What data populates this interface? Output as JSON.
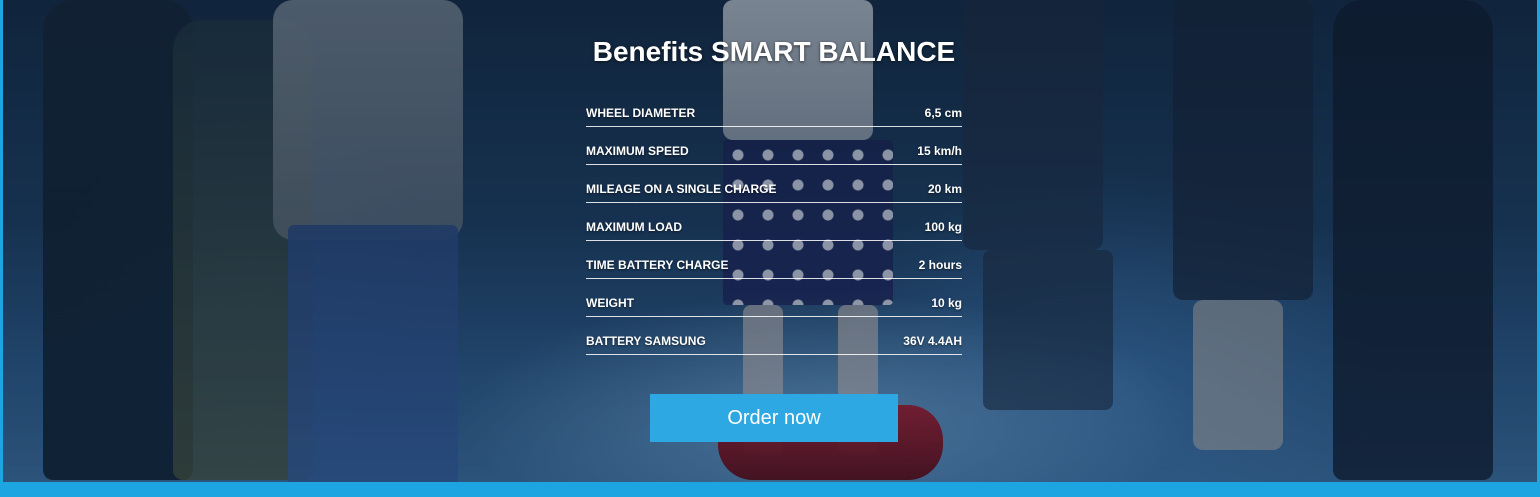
{
  "section": {
    "title": "Benefits SMART BALANCE",
    "specs": [
      {
        "label": "WHEEL DIAMETER",
        "value": "6,5 cm"
      },
      {
        "label": "MAXIMUM SPEED",
        "value": "15 km/h"
      },
      {
        "label": "MILEAGE ON A SINGLE CHARGE",
        "value": "20 km"
      },
      {
        "label": "MAXIMUM LOAD",
        "value": "100 kg"
      },
      {
        "label": "TIME BATTERY CHARGE",
        "value": "2 hours"
      },
      {
        "label": "WEIGHT",
        "value": "10 kg"
      },
      {
        "label": "BATTERY SAMSUNG",
        "value": "36V 4.4AH"
      }
    ],
    "order_button": "Order now"
  },
  "colors": {
    "accent": "#1ca5e0",
    "button": "#2da8e2",
    "text": "#ffffff"
  }
}
